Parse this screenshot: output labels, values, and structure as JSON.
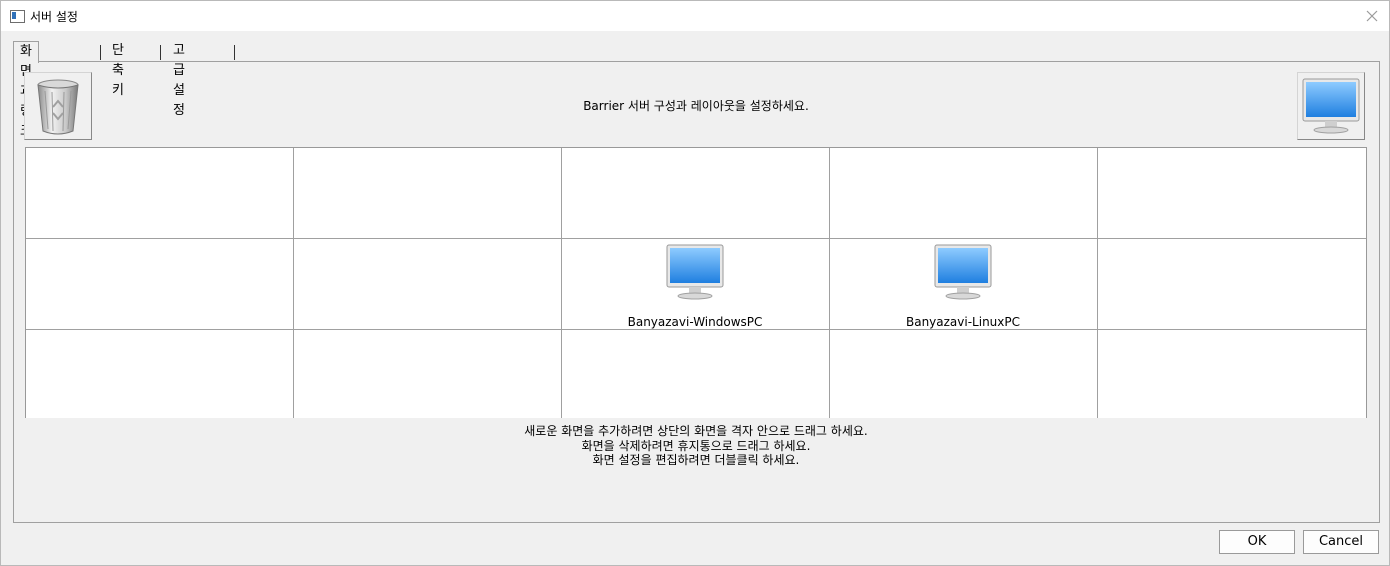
{
  "window": {
    "title": "서버 설정"
  },
  "tabs": [
    {
      "label": "화면과 링크",
      "active": true
    },
    {
      "label": "단축키",
      "active": false
    },
    {
      "label": "고급 설정",
      "active": false
    }
  ],
  "layout_tab": {
    "instruction": "Barrier 서버 구성과 레이아웃을 설정하세요.",
    "trash_icon": "recycle-bin-icon",
    "new_screen_icon": "monitor-icon",
    "screens": [
      {
        "name": "Banyazavi-WindowsPC"
      },
      {
        "name": "Banyazavi-LinuxPC"
      }
    ],
    "hints": [
      "새로운 화면을 추가하려면 상단의 화면을 격자 안으로 드래그 하세요.",
      "화면을 삭제하려면 휴지통으로 드래그 하세요.",
      "화면 설정을 편집하려면 더블클릭 하세요."
    ]
  },
  "buttons": {
    "ok": "OK",
    "cancel": "Cancel"
  }
}
